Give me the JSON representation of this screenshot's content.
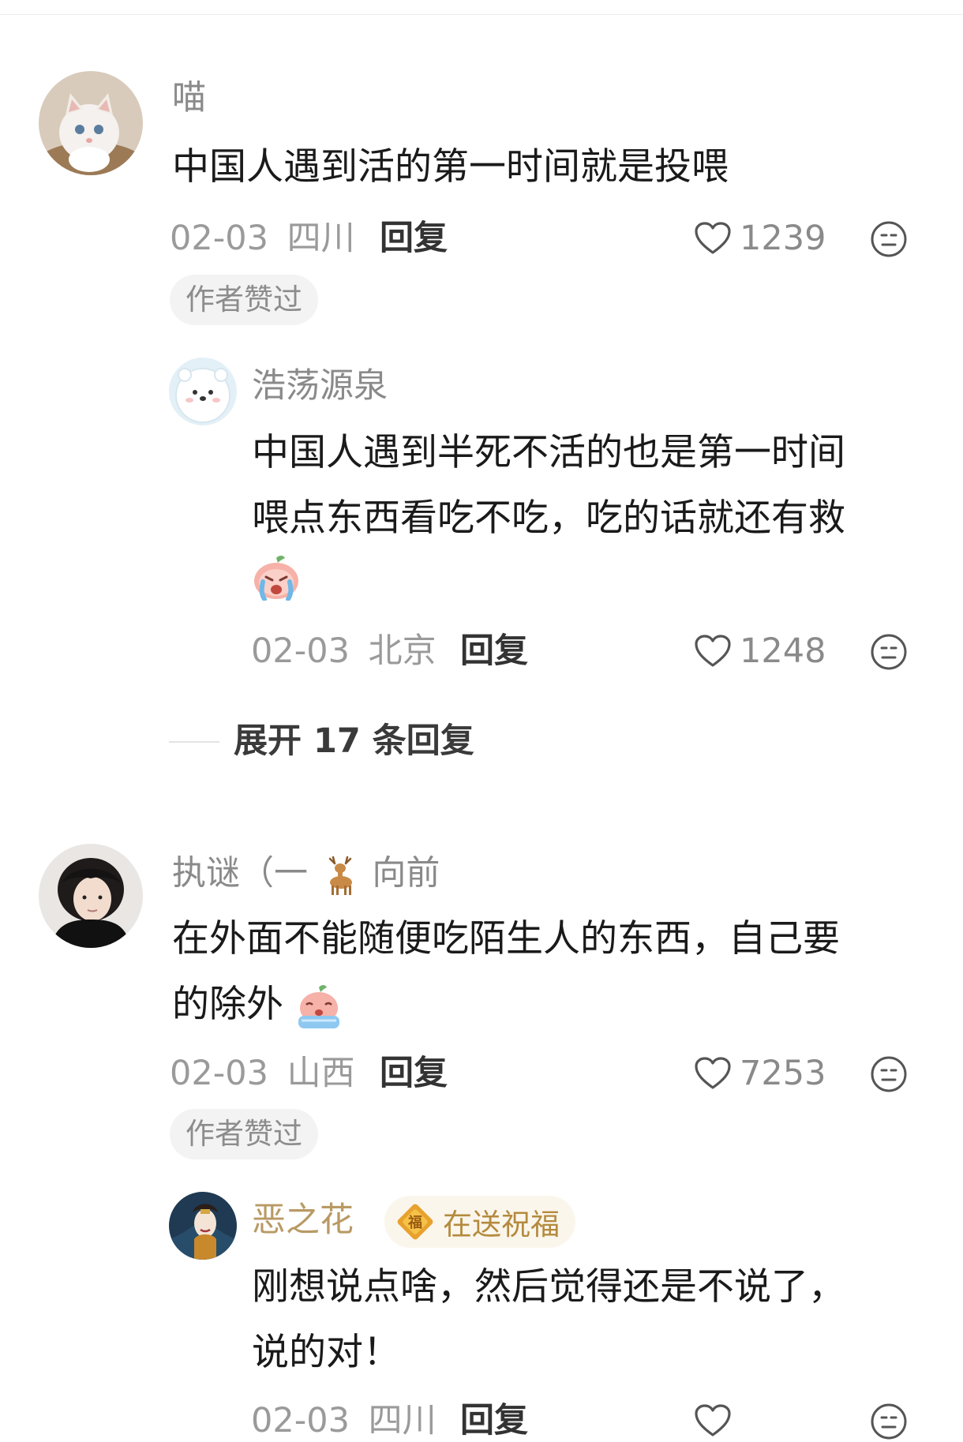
{
  "comments": [
    {
      "username": "喵",
      "text": "中国人遇到活的第一时间就是投喂",
      "date": "02-03",
      "location": "四川",
      "reply_label": "回复",
      "likes": "1239",
      "badge": "作者赞过",
      "replies": [
        {
          "username": "浩荡源泉",
          "text_lines": [
            "中国人遇到半死不活的也是第一时间",
            "喂点东西看吃不吃，吃的话就还有救"
          ],
          "date": "02-03",
          "location": "北京",
          "reply_label": "回复",
          "likes": "1248"
        }
      ],
      "expand_label": "展开 17 条回复"
    },
    {
      "username_prefix": "执谜（一",
      "username_suffix": "向前",
      "text_lines": [
        "在外面不能随便吃陌生人的东西，自己要",
        "的除外"
      ],
      "date": "02-03",
      "location": "山西",
      "reply_label": "回复",
      "likes": "7253",
      "badge": "作者赞过",
      "replies": [
        {
          "username": "恶之花",
          "blessing_label": "在送祝福",
          "text_lines": [
            "刚想说点啥，然后觉得还是不说了，",
            "说的对！"
          ],
          "date": "02-03",
          "location": "四川",
          "reply_label": "回复"
        }
      ]
    }
  ],
  "colors": {
    "username": "#8a8a8a",
    "gold_username": "#b89a64",
    "text": "#1a1a1a",
    "meta": "#9a9a9a",
    "badge_bg": "#f3f3f3",
    "blessing_text": "#b48a3e"
  }
}
